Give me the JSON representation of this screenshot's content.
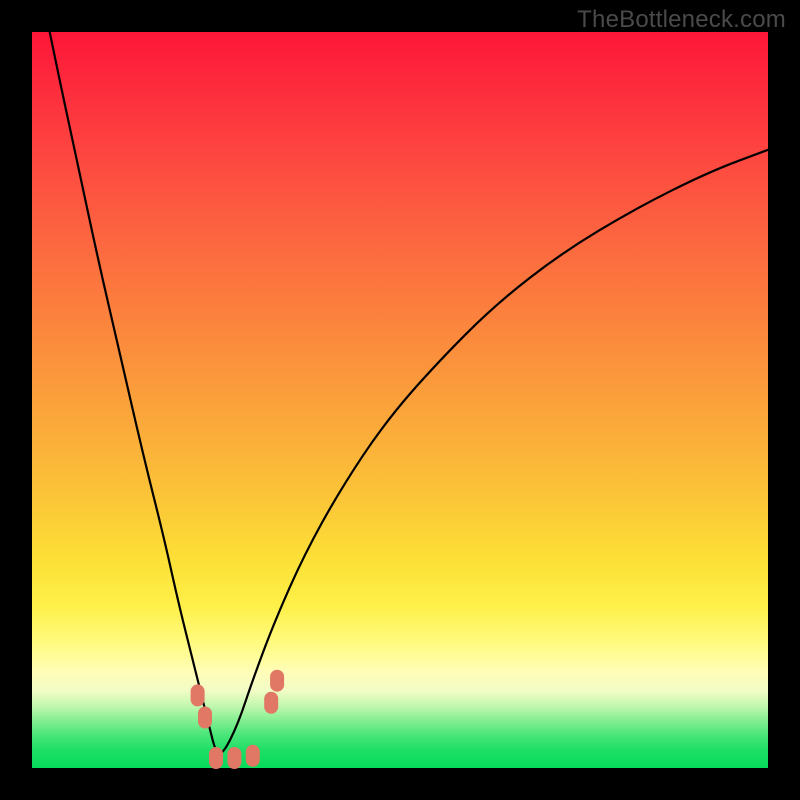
{
  "watermark": "TheBottleneck.com",
  "colors": {
    "frame": "#000000",
    "curve": "#000000",
    "marker": "#e07865",
    "gradient_top": "#fd1638",
    "gradient_bottom": "#05db5c"
  },
  "chart_data": {
    "type": "line",
    "title": "",
    "xlabel": "",
    "ylabel": "",
    "xlim": [
      0,
      100
    ],
    "ylim": [
      0,
      100
    ],
    "grid": false,
    "legend": false,
    "note": "V-shaped bottleneck curve over red-to-green gradient; y is bottleneck percentage (0 at bottom). Minimum (optimal balance) near x≈25.",
    "series": [
      {
        "name": "bottleneck-curve",
        "x": [
          0,
          3,
          6,
          9,
          12,
          15,
          18,
          20,
          22,
          24,
          25,
          26,
          28,
          30,
          33,
          37,
          42,
          48,
          55,
          63,
          72,
          82,
          92,
          100
        ],
        "y": [
          112,
          97,
          83,
          69,
          56,
          43,
          31,
          22,
          14,
          6,
          2,
          2,
          6,
          12,
          20,
          29,
          38,
          47,
          55,
          63,
          70,
          76,
          81,
          84
        ]
      }
    ],
    "markers": [
      {
        "name": "left-cluster-a",
        "x": 22.5,
        "y": 10
      },
      {
        "name": "left-cluster-b",
        "x": 23.5,
        "y": 7
      },
      {
        "name": "bottom-a",
        "x": 25,
        "y": 1.5
      },
      {
        "name": "bottom-b",
        "x": 27.5,
        "y": 1.5
      },
      {
        "name": "bottom-c",
        "x": 30,
        "y": 1.8
      },
      {
        "name": "right-cluster-a",
        "x": 32.5,
        "y": 9
      },
      {
        "name": "right-cluster-b",
        "x": 33.3,
        "y": 12
      }
    ]
  }
}
